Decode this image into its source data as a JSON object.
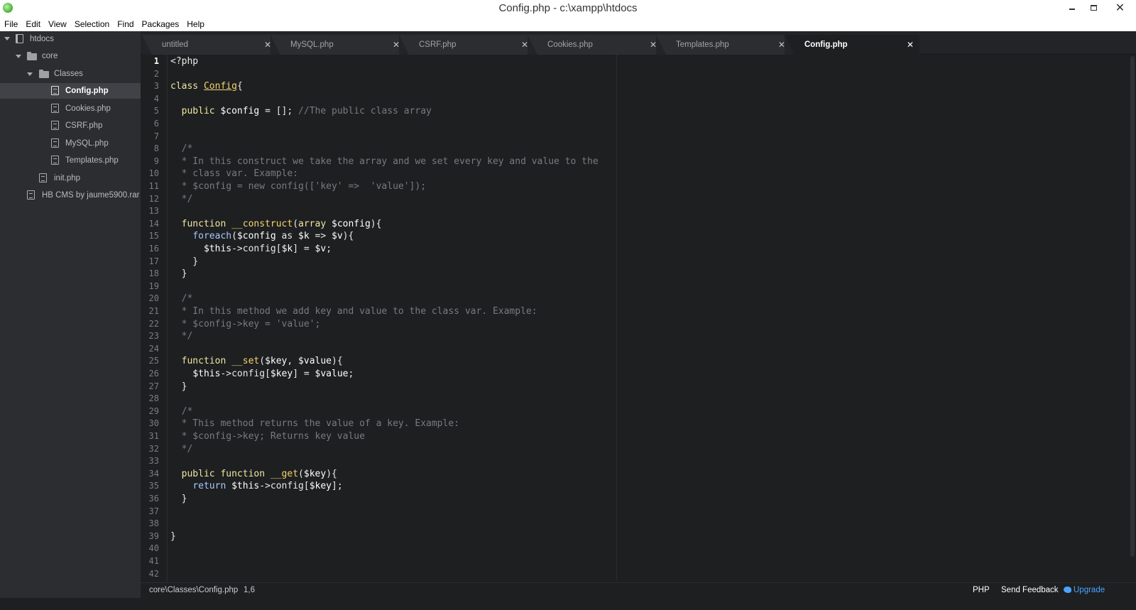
{
  "window": {
    "title": "Config.php - c:\\xampp\\htdocs"
  },
  "menu": [
    "File",
    "Edit",
    "View",
    "Selection",
    "Find",
    "Packages",
    "Help"
  ],
  "tree": {
    "root": "htdocs",
    "core": "core",
    "classes": "Classes",
    "files": [
      "Config.php",
      "Cookies.php",
      "CSRF.php",
      "MySQL.php",
      "Templates.php"
    ],
    "init": "init.php",
    "archive": "HB CMS by jaume5900.rar",
    "selected": "Config.php"
  },
  "tabs": [
    "untitled",
    "MySQL.php",
    "CSRF.php",
    "Cookies.php",
    "Templates.php",
    "Config.php"
  ],
  "active_tab": "Config.php",
  "current_line": 1,
  "line_count": 42,
  "status": {
    "path": "core\\Classes\\Config.php",
    "position": "1,6",
    "language": "PHP",
    "feedback": "Send Feedback",
    "upgrade": "Upgrade"
  },
  "code": [
    {
      "t": [
        [
          "plain",
          "<?php"
        ]
      ]
    },
    {
      "t": []
    },
    {
      "t": [
        [
          "kw",
          "class "
        ],
        [
          "cls",
          "Config"
        ],
        [
          "plain",
          "{"
        ]
      ]
    },
    {
      "t": []
    },
    {
      "t": [
        [
          "plain",
          "  "
        ],
        [
          "kw",
          "public "
        ],
        [
          "var",
          "$config"
        ],
        [
          "plain",
          " = []; "
        ],
        [
          "comment",
          "//The public class array"
        ]
      ]
    },
    {
      "t": []
    },
    {
      "t": []
    },
    {
      "t": [
        [
          "comment",
          "  /*"
        ]
      ]
    },
    {
      "t": [
        [
          "comment",
          "  * In this construct we take the array and we set every key and value to the"
        ]
      ]
    },
    {
      "t": [
        [
          "comment",
          "  * class var. Example:"
        ]
      ]
    },
    {
      "t": [
        [
          "comment",
          "  * $config = new config(['key' =>  'value']);"
        ]
      ]
    },
    {
      "t": [
        [
          "comment",
          "  */"
        ]
      ]
    },
    {
      "t": []
    },
    {
      "t": [
        [
          "plain",
          "  "
        ],
        [
          "kw",
          "function "
        ],
        [
          "fn",
          "__construct"
        ],
        [
          "plain",
          "("
        ],
        [
          "kw",
          "array "
        ],
        [
          "var",
          "$config"
        ],
        [
          "plain",
          "){"
        ]
      ]
    },
    {
      "t": [
        [
          "plain",
          "    "
        ],
        [
          "kw2",
          "foreach"
        ],
        [
          "plain",
          "("
        ],
        [
          "var",
          "$config"
        ],
        [
          "plain",
          " as "
        ],
        [
          "var",
          "$k"
        ],
        [
          "plain",
          " => "
        ],
        [
          "var",
          "$v"
        ],
        [
          "plain",
          "){"
        ]
      ]
    },
    {
      "t": [
        [
          "plain",
          "      "
        ],
        [
          "var",
          "$this"
        ],
        [
          "plain",
          "->config["
        ],
        [
          "var",
          "$k"
        ],
        [
          "plain",
          "] = "
        ],
        [
          "var",
          "$v"
        ],
        [
          "plain",
          ";"
        ]
      ]
    },
    {
      "t": [
        [
          "plain",
          "    }"
        ]
      ]
    },
    {
      "t": [
        [
          "plain",
          "  }"
        ]
      ]
    },
    {
      "t": []
    },
    {
      "t": [
        [
          "comment",
          "  /*"
        ]
      ]
    },
    {
      "t": [
        [
          "comment",
          "  * In this method we add key and value to the class var. Example:"
        ]
      ]
    },
    {
      "t": [
        [
          "comment",
          "  * $config->key = 'value';"
        ]
      ]
    },
    {
      "t": [
        [
          "comment",
          "  */"
        ]
      ]
    },
    {
      "t": []
    },
    {
      "t": [
        [
          "plain",
          "  "
        ],
        [
          "kw",
          "function "
        ],
        [
          "fn",
          "__set"
        ],
        [
          "plain",
          "("
        ],
        [
          "var",
          "$key"
        ],
        [
          "plain",
          ", "
        ],
        [
          "var",
          "$value"
        ],
        [
          "plain",
          "){"
        ]
      ]
    },
    {
      "t": [
        [
          "plain",
          "    "
        ],
        [
          "var",
          "$this"
        ],
        [
          "plain",
          "->config["
        ],
        [
          "var",
          "$key"
        ],
        [
          "plain",
          "] = "
        ],
        [
          "var",
          "$value"
        ],
        [
          "plain",
          ";"
        ]
      ]
    },
    {
      "t": [
        [
          "plain",
          "  }"
        ]
      ]
    },
    {
      "t": []
    },
    {
      "t": [
        [
          "comment",
          "  /*"
        ]
      ]
    },
    {
      "t": [
        [
          "comment",
          "  * This method returns the value of a key. Example:"
        ]
      ]
    },
    {
      "t": [
        [
          "comment",
          "  * $config->key; Returns key value"
        ]
      ]
    },
    {
      "t": [
        [
          "comment",
          "  */"
        ]
      ]
    },
    {
      "t": []
    },
    {
      "t": [
        [
          "plain",
          "  "
        ],
        [
          "kw",
          "public "
        ],
        [
          "kw",
          "function "
        ],
        [
          "fn",
          "__get"
        ],
        [
          "plain",
          "("
        ],
        [
          "var",
          "$key"
        ],
        [
          "plain",
          "){"
        ]
      ]
    },
    {
      "t": [
        [
          "plain",
          "    "
        ],
        [
          "kw2",
          "return "
        ],
        [
          "var",
          "$this"
        ],
        [
          "plain",
          "->config["
        ],
        [
          "var",
          "$key"
        ],
        [
          "plain",
          "];"
        ]
      ]
    },
    {
      "t": [
        [
          "plain",
          "  }"
        ]
      ]
    },
    {
      "t": []
    },
    {
      "t": []
    },
    {
      "t": [
        [
          "plain",
          "}"
        ]
      ]
    },
    {
      "t": []
    },
    {
      "t": []
    },
    {
      "t": []
    }
  ]
}
